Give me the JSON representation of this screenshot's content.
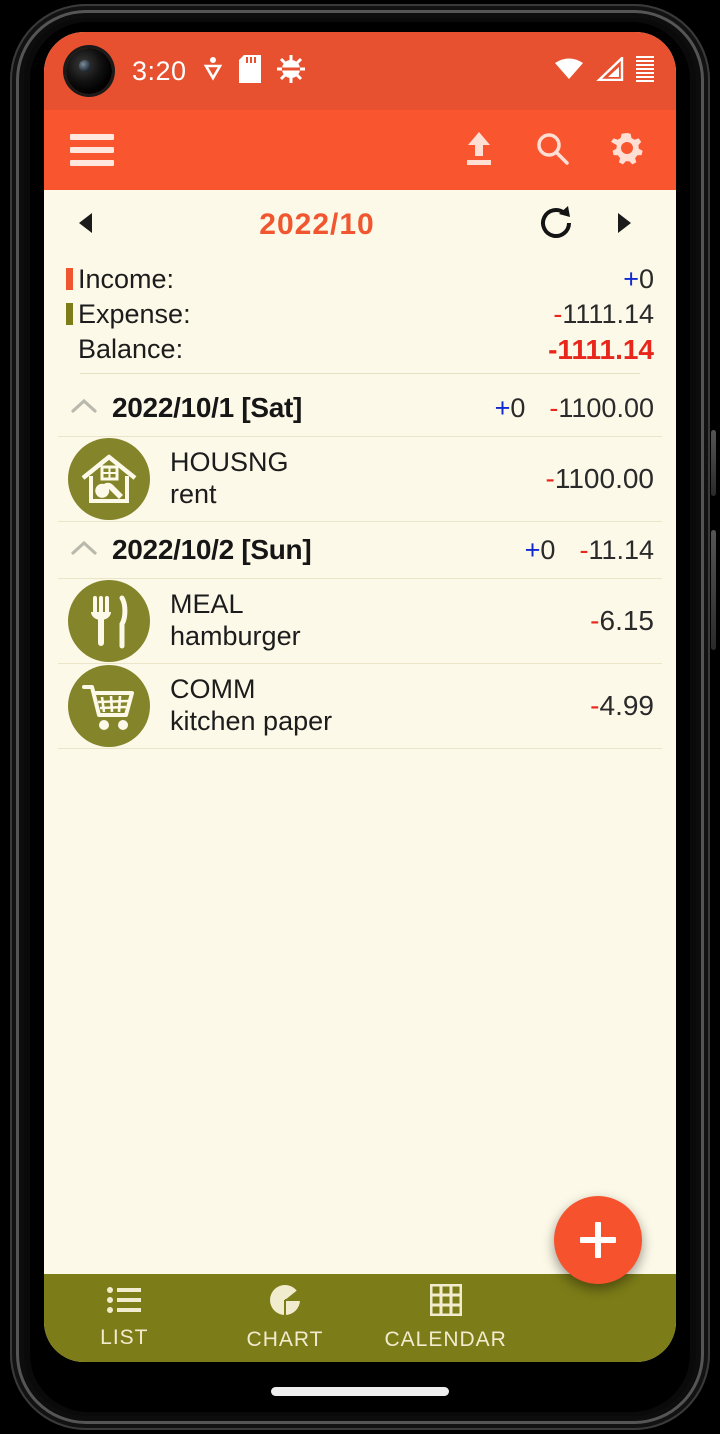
{
  "status_bar": {
    "time": "3:20",
    "icons_left": [
      "download-icon",
      "sd-card-icon",
      "bug-icon"
    ],
    "icons_right": [
      "wifi-icon",
      "cell-signal-icon",
      "battery-icon"
    ],
    "background_color": "#e8512f"
  },
  "app_bar": {
    "menu_icon": "hamburger-menu-icon",
    "actions": [
      {
        "name": "export-icon",
        "label": "Export"
      },
      {
        "name": "search-icon",
        "label": "Search"
      },
      {
        "name": "settings-icon",
        "label": "Settings"
      }
    ],
    "background_color": "#f9552f"
  },
  "month_nav": {
    "prev_label": "◂",
    "month": "2022/10",
    "refresh_label": "Refresh",
    "next_label": "▸",
    "month_color": "#f0562f"
  },
  "summary": {
    "income": {
      "label": "Income:",
      "sign": "+",
      "amount": "0",
      "swatch_color": "#f0562f"
    },
    "expense": {
      "label": "Expense:",
      "sign": "-",
      "amount": "1111.14",
      "swatch_color": "#7c7c18"
    },
    "balance": {
      "label": "Balance:",
      "sign": "-",
      "amount": "1111.14",
      "color": "#e8261b"
    }
  },
  "groups": [
    {
      "date": "2022/10/1 [Sat]",
      "income_sign": "+",
      "income": "0",
      "expense_sign": "-",
      "expense": "1100.00",
      "entries": [
        {
          "icon": "house-wrench-icon",
          "category": "HOUSNG",
          "note": "rent",
          "sign": "-",
          "amount": "1100.00"
        }
      ]
    },
    {
      "date": "2022/10/2 [Sun]",
      "income_sign": "+",
      "income": "0",
      "expense_sign": "-",
      "expense": "11.14",
      "entries": [
        {
          "icon": "fork-knife-icon",
          "category": "MEAL",
          "note": "hamburger",
          "sign": "-",
          "amount": "6.15"
        },
        {
          "icon": "shopping-cart-icon",
          "category": "COMM",
          "note": "kitchen paper",
          "sign": "-",
          "amount": "4.99"
        }
      ]
    }
  ],
  "bottom_nav": {
    "items": [
      {
        "icon": "list-icon",
        "label": "LIST"
      },
      {
        "icon": "pie-chart-icon",
        "label": "CHART"
      },
      {
        "icon": "calendar-grid-icon",
        "label": "CALENDAR"
      }
    ],
    "background_color": "#7c7c18"
  },
  "fab": {
    "icon": "plus-icon",
    "label": "Add",
    "color": "#f6522d"
  },
  "theme": {
    "page_background": "#fdf9e8",
    "category_icon_color": "#84842a",
    "positive_color": "#1028d0",
    "negative_color": "#e8261b"
  }
}
